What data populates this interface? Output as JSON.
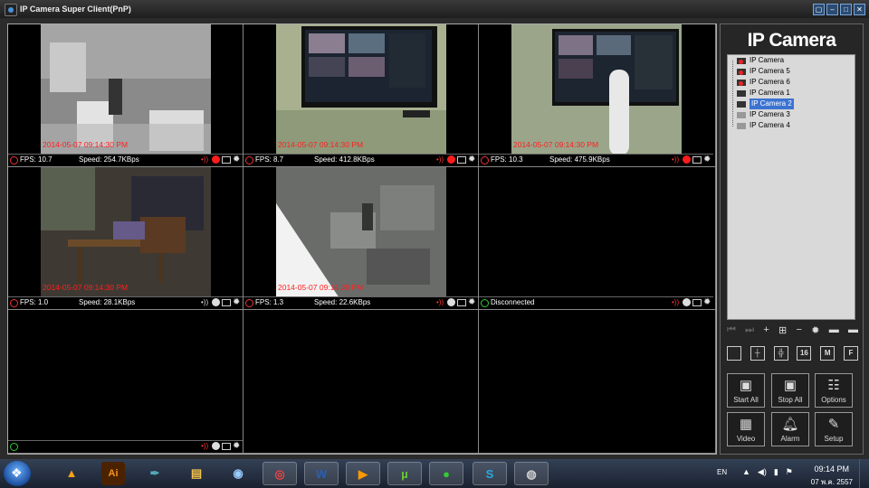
{
  "window": {
    "title": "IP Camera Super Client(PnP)"
  },
  "cells": [
    {
      "fps": "FPS: 10.7",
      "speed": "Speed: 254.7KBps",
      "timestamp": "2014-05-07 09:14:30 PM",
      "rec_color": "#ff1c1c"
    },
    {
      "fps": "FPS: 8.7",
      "speed": "Speed: 412.8KBps",
      "timestamp": "2014-05-07 09:14:30 PM",
      "rec_color": "#ff1c1c"
    },
    {
      "fps": "FPS: 10.3",
      "speed": "Speed: 475.9KBps",
      "timestamp": "2014-05-07 09:14:30 PM",
      "rec_color": "#ff1c1c"
    },
    {
      "fps": "FPS: 1.0",
      "speed": "Speed: 28.1KBps",
      "timestamp": "2014-05-07 09:14:30 PM",
      "rec_color": "#dddddd"
    },
    {
      "fps": "FPS: 1.3",
      "speed": "Speed: 22.6KBps",
      "timestamp": "2014-05-07 09:14:29 PM",
      "rec_color": "#dddddd"
    },
    {
      "status": "Disconnected"
    }
  ],
  "sidebar": {
    "brand": "IP Camera",
    "tree": [
      {
        "label": "IP Camera",
        "state": "red"
      },
      {
        "label": "IP Camera 5",
        "state": "red"
      },
      {
        "label": "IP Camera 6",
        "state": "red"
      },
      {
        "label": "IP Camera 1",
        "state": "dark"
      },
      {
        "label": "IP Camera 2",
        "state": "dark",
        "selected": true
      },
      {
        "label": "IP Camera 3",
        "state": "grey"
      },
      {
        "label": "IP Camera 4",
        "state": "grey"
      }
    ],
    "layout_buttons": [
      "",
      "",
      "",
      "16",
      "M",
      "F"
    ],
    "buttons": {
      "start_all": "Start All",
      "stop_all": "Stop All",
      "options": "Options",
      "video": "Video",
      "alarm": "Alarm",
      "setup": "Setup"
    }
  },
  "taskbar": {
    "lang": "EN",
    "time": "09:14 PM",
    "date": "07 พ.ค. 2557",
    "apps": [
      "vlc-icon",
      "illustrator-icon",
      "feather-icon",
      "folder-icon",
      "network-icon",
      "chrome-icon",
      "word-icon",
      "media-icon",
      "utorrent-icon",
      "line-icon",
      "skype-icon",
      "webcam-icon"
    ]
  }
}
